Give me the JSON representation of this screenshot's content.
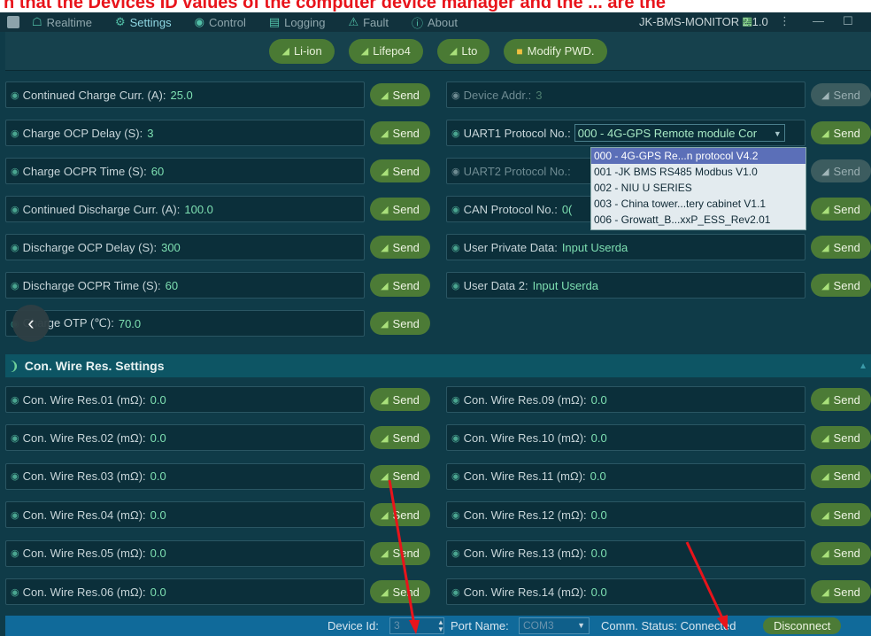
{
  "banner_text": "n that the Devices ID values of the computer device manager and the ... are the",
  "tabs": [
    {
      "label": "Realtime",
      "icon": "monitor-icon",
      "glyph": "☖",
      "active": false
    },
    {
      "label": "Settings",
      "icon": "gear-icon",
      "glyph": "⚙",
      "active": true
    },
    {
      "label": "Control",
      "icon": "toggle-icon",
      "glyph": "◉",
      "active": false
    },
    {
      "label": "Logging",
      "icon": "log-icon",
      "glyph": "▤",
      "active": false
    },
    {
      "label": "Fault",
      "icon": "fault-icon",
      "glyph": "⚠",
      "active": false
    },
    {
      "label": "About",
      "icon": "info-icon",
      "glyph": "ⓘ",
      "active": false
    }
  ],
  "window_title": "JK-BMS-MONITOR 2.1.0",
  "mode_buttons": [
    "Li-ion",
    "Lifepo4",
    "Lto"
  ],
  "modify_pwd_label": "Modify PWD.",
  "send_label": "Send",
  "left_settings": [
    {
      "label": "Continued Charge Curr. (A):",
      "value": "25.0"
    },
    {
      "label": "Charge OCP Delay (S):",
      "value": "3"
    },
    {
      "label": "Charge OCPR Time (S):",
      "value": "60"
    },
    {
      "label": "Continued Discharge Curr. (A):",
      "value": "100.0"
    },
    {
      "label": "Discharge OCP Delay (S):",
      "value": "300"
    },
    {
      "label": "Discharge OCPR Time (S):",
      "value": "60"
    },
    {
      "label": "Charge OTP (℃):",
      "value": "70.0"
    }
  ],
  "right_settings": [
    {
      "label": "Device Addr.:",
      "value": "3",
      "enabled": false
    },
    {
      "label": "UART1 Protocol No.:",
      "value": "000 - 4G-GPS Remote module Cor",
      "enabled": true,
      "combo": true
    },
    {
      "label": "UART2 Protocol No.:",
      "value": "",
      "enabled": false
    },
    {
      "label": "CAN Protocol No.:",
      "value": "0(",
      "enabled": true
    },
    {
      "label": "User Private Data:",
      "value": "Input Userda",
      "enabled": true
    },
    {
      "label": "User Data 2:",
      "value": "Input Userda",
      "enabled": true
    }
  ],
  "protocol_options": [
    "000 - 4G-GPS Re...n protocol V4.2",
    "001 -JK BMS RS485 Modbus V1.0",
    "002 - NIU U SERIES",
    "003 - China tower...tery cabinet V1.1",
    "006 - Growatt_B...xxP_ESS_Rev2.01"
  ],
  "section_title": "Con. Wire Res. Settings",
  "wire_left": [
    {
      "label": "Con. Wire Res.01 (mΩ):",
      "value": "0.0"
    },
    {
      "label": "Con. Wire Res.02 (mΩ):",
      "value": "0.0"
    },
    {
      "label": "Con. Wire Res.03 (mΩ):",
      "value": "0.0"
    },
    {
      "label": "Con. Wire Res.04 (mΩ):",
      "value": "0.0"
    },
    {
      "label": "Con. Wire Res.05 (mΩ):",
      "value": "0.0"
    },
    {
      "label": "Con. Wire Res.06 (mΩ):",
      "value": "0.0"
    }
  ],
  "wire_right": [
    {
      "label": "Con. Wire Res.09 (mΩ):",
      "value": "0.0"
    },
    {
      "label": "Con. Wire Res.10 (mΩ):",
      "value": "0.0"
    },
    {
      "label": "Con. Wire Res.11 (mΩ):",
      "value": "0.0"
    },
    {
      "label": "Con. Wire Res.12 (mΩ):",
      "value": "0.0"
    },
    {
      "label": "Con. Wire Res.13 (mΩ):",
      "value": "0.0"
    },
    {
      "label": "Con. Wire Res.14 (mΩ):",
      "value": "0.0"
    }
  ],
  "status": {
    "device_id_label": "Device Id:",
    "device_id_value": "3",
    "port_label": "Port Name:",
    "port_value": "COM3",
    "comm_label": "Comm. Status: Connected",
    "disconnect_label": "Disconnect"
  },
  "colors": {
    "accent_green": "#4c7b36",
    "value_green": "#7ee0b2",
    "annotation_red": "#e8141b",
    "status_blue": "#106a9a"
  }
}
